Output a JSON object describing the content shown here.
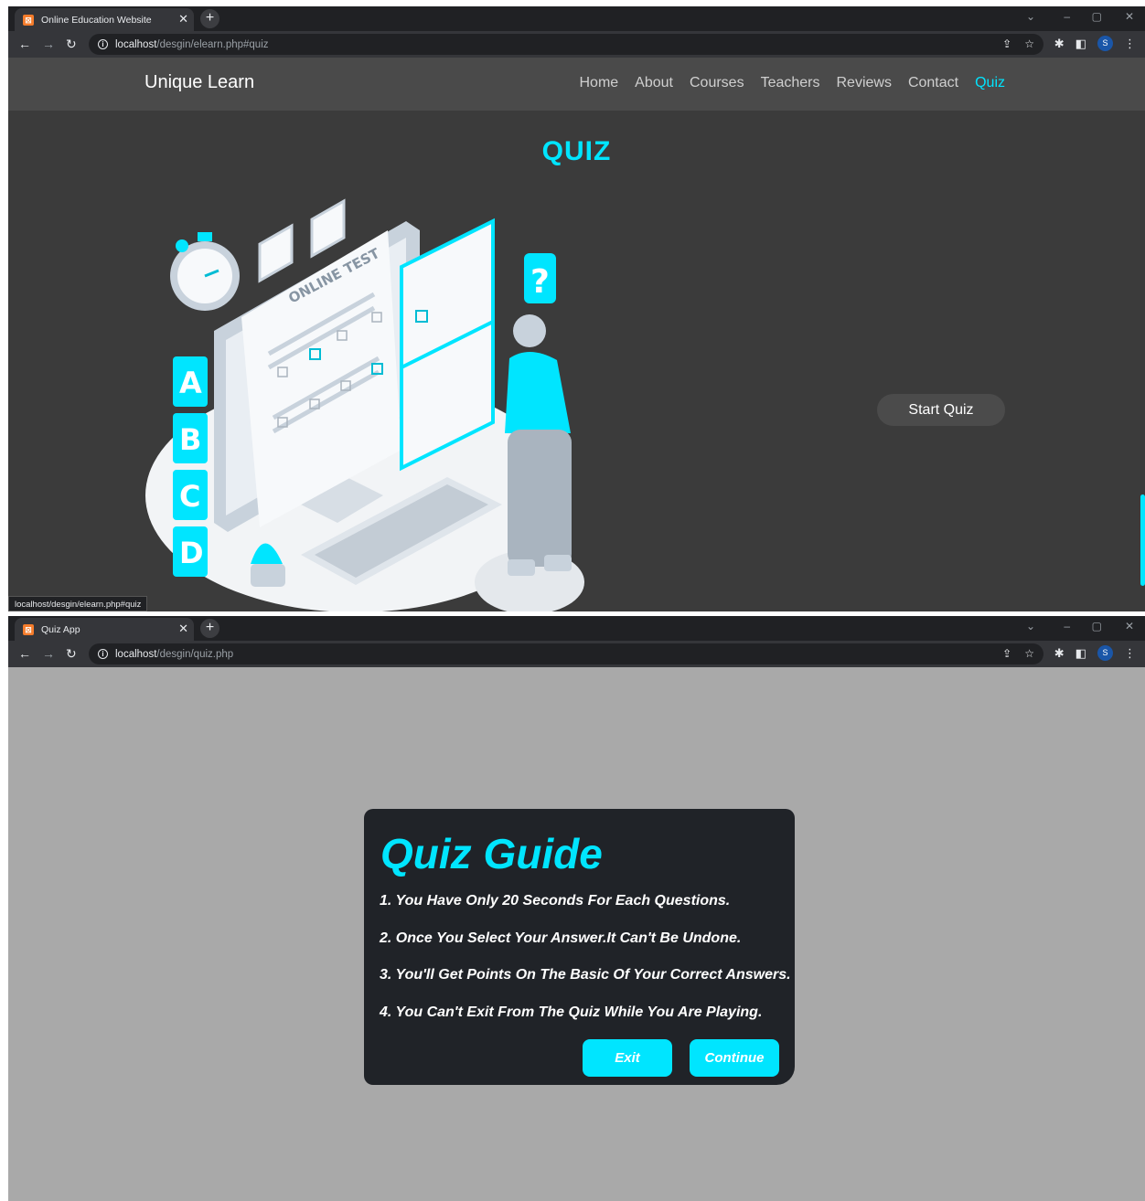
{
  "window1": {
    "tab_title": "Online Education Website",
    "url_host": "localhost",
    "url_path": "/desgin/elearn.php#quiz",
    "status_url": "localhost/desgin/elearn.php#quiz"
  },
  "site": {
    "logo": "Unique Learn",
    "nav": [
      "Home",
      "About",
      "Courses",
      "Teachers",
      "Reviews",
      "Contact",
      "Quiz"
    ],
    "active_nav": "Quiz",
    "section_title": "QUIZ",
    "illustration_text": "ONLINE TEST",
    "illustration_letters": [
      "A",
      "B",
      "C",
      "D"
    ],
    "start_button": "Start Quiz"
  },
  "window2": {
    "tab_title": "Quiz App",
    "url_host": "localhost",
    "url_path": "/desgin/quiz.php"
  },
  "guide": {
    "title": "Quiz Guide",
    "rules": [
      "1. You Have Only 20 Seconds For Each Questions.",
      "2. Once You Select Your Answer.It Can't Be Undone.",
      "3. You'll Get Points On The Basic Of Your Correct Answers.",
      "4. You Can't Exit From The Quiz While You Are Playing."
    ],
    "exit_button": "Exit",
    "continue_button": "Continue"
  },
  "colors": {
    "accent": "#00e5ff",
    "page_dark": "#3b3b3b",
    "modal_bg": "#202328",
    "overlay_bg": "#a9a9a9"
  },
  "profile_initial": "S"
}
